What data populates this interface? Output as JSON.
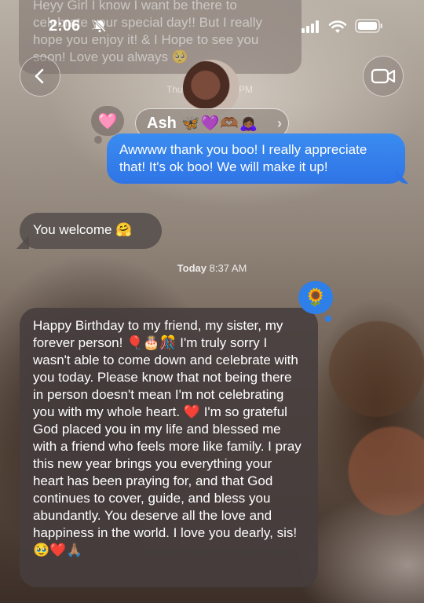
{
  "status_bar": {
    "time": "2:06"
  },
  "faded_previous_message": "Heyy Girl I know I want be there to celebrate your special day!! But I really hope you enjoy it! & I Hope to see you soon! Love you always 🥺",
  "header": {
    "contact_name": "Ash",
    "contact_emojis": "🦋💜🫶🏾🙇🏾‍♀️",
    "time_label_left": "Thu",
    "time_label_right": "PM",
    "contact_reaction": "🩷"
  },
  "messages": {
    "outgoing_1": "Awwww thank you boo! I really appreciate that! It's ok boo! We will make it up!",
    "incoming_1": "You welcome 🤗",
    "timestamp_day": "Today",
    "timestamp_time": "8:37 AM",
    "reaction_2": "🌻",
    "incoming_2": "Happy Birthday to my friend, my sister, my forever person! 🎈🎂🎊 I'm truly sorry I wasn't able to come down and celebrate with you today. Please know that not being there in person doesn't mean I'm not celebrating you with my whole heart. ❤️ I'm so grateful God placed you in my life and blessed me with a friend who feels more like family. I pray this new year brings you everything your heart has been praying for, and that God continues to cover, guide, and bless you abundantly. You deserve all the love and happiness in the world. I love you dearly, sis! 🥹❤️🙏🏽"
  },
  "colors": {
    "outgoing_bubble": "#3a8cf0",
    "incoming_bubble": "#4a4040"
  },
  "icons": {
    "back": "chevron-left-icon",
    "video": "video-camera-icon",
    "mute": "bell-slash-icon"
  }
}
